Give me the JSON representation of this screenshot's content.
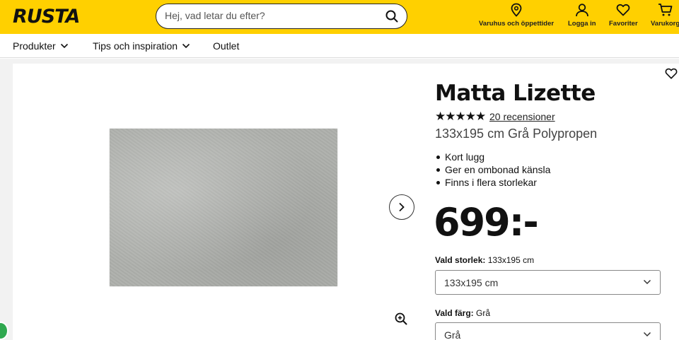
{
  "header": {
    "logo": "RUSTA",
    "search_placeholder": "Hej, vad letar du efter?",
    "items": [
      {
        "label": "Varuhus och öppettider",
        "icon": "location-pin-icon"
      },
      {
        "label": "Logga in",
        "icon": "user-icon"
      },
      {
        "label": "Favoriter",
        "icon": "heart-icon"
      },
      {
        "label": "Varukorg",
        "icon": "cart-icon"
      }
    ]
  },
  "nav": {
    "items": [
      {
        "label": "Produkter"
      },
      {
        "label": "Tips och inspiration"
      },
      {
        "label": "Outlet"
      }
    ]
  },
  "product": {
    "title": "Matta Lizette",
    "stars": "★★★★★",
    "rating_value": 5,
    "reviews": "20 recensioner",
    "subtitle": "133x195 cm Grå Polypropen",
    "bullets": [
      "Kort lugg",
      "Ger en ombonad känsla",
      "Finns i flera storlekar"
    ],
    "price": "699:-",
    "size_label": "Vald storlek:",
    "size_value": "133x195 cm",
    "size_select": "133x195 cm",
    "color_label": "Vald färg:",
    "color_value": "Grå",
    "color_select": "Grå"
  },
  "colors": {
    "brand_yellow": "#ffd000",
    "chat_green": "#2fa84f"
  }
}
